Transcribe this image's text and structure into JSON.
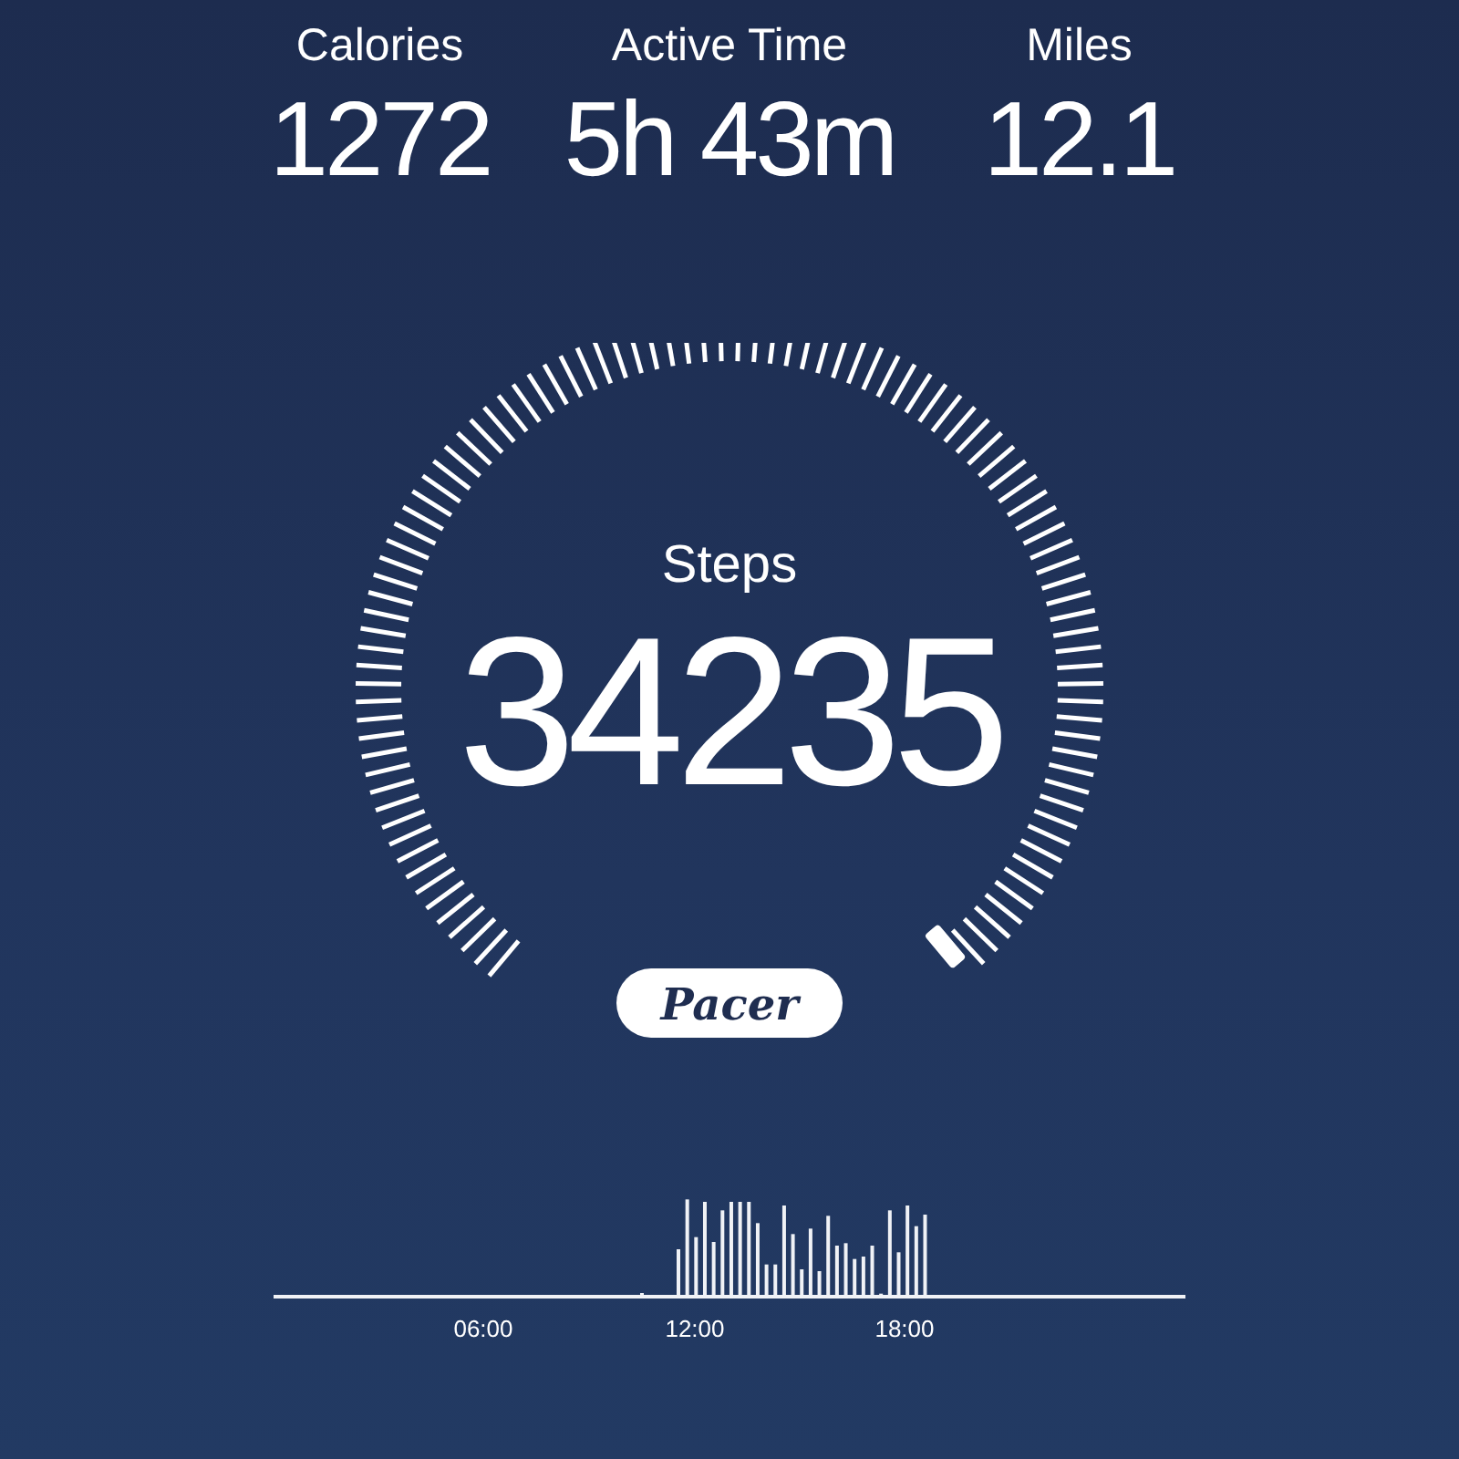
{
  "stats": [
    {
      "label": "Calories",
      "value": "1272"
    },
    {
      "label": "Active Time",
      "value": "5h 43m"
    },
    {
      "label": "Miles",
      "value": "12.1"
    }
  ],
  "gauge": {
    "label": "Steps",
    "value": "34235"
  },
  "logo": "Pacer",
  "activity": {
    "time_labels": [
      "06:00",
      "12:00",
      "18:00"
    ]
  }
}
